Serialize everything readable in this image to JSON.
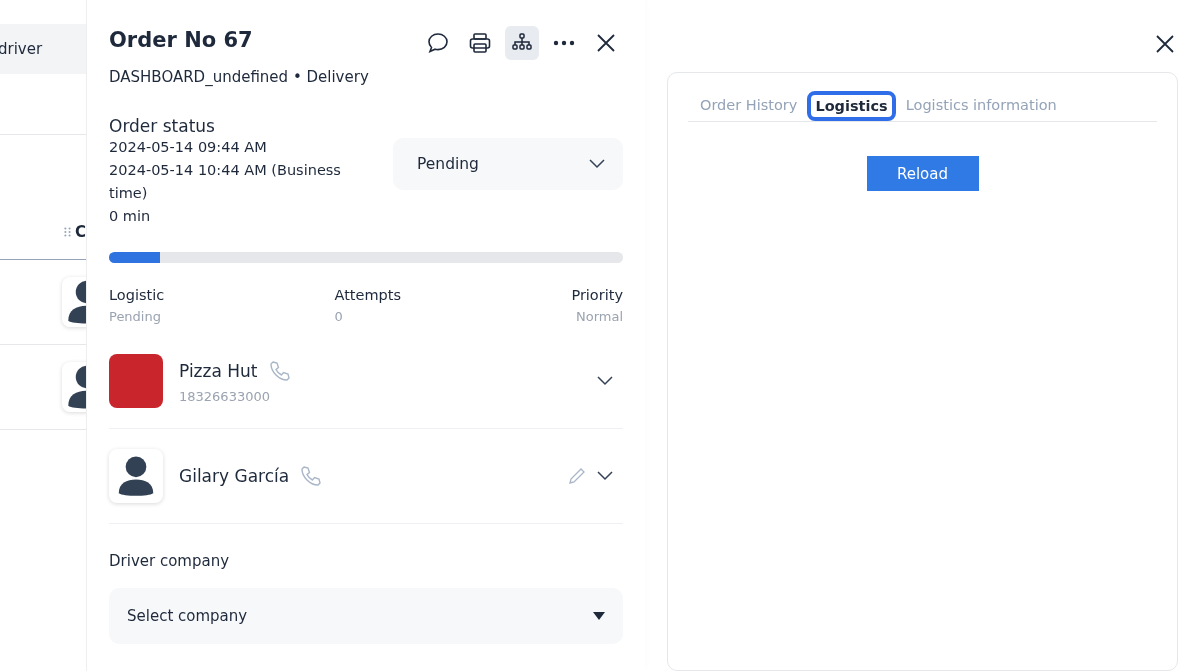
{
  "background": {
    "header_text": "driver",
    "column_header": "C",
    "rows": [
      {
        "avatar": true
      },
      {
        "avatar": true
      }
    ]
  },
  "order": {
    "title": "Order No 67",
    "subtitle": "DASHBOARD_undefined • Delivery",
    "toolbar": [
      {
        "kind": "chat",
        "selected": false
      },
      {
        "kind": "print",
        "selected": false
      },
      {
        "kind": "tree",
        "selected": true
      },
      {
        "kind": "more",
        "selected": false
      },
      {
        "kind": "close",
        "selected": false
      }
    ],
    "status_label": "Order status",
    "times": [
      "2024-05-14 09:44 AM",
      "2024-05-14 10:44 AM (Business time)",
      "0 min"
    ],
    "status_select": {
      "value": "Pending"
    },
    "progress": {
      "level": 0.1
    },
    "stats": [
      {
        "label": "Logistic",
        "value": "Pending"
      },
      {
        "label": "Attempts",
        "value": "0"
      },
      {
        "label": "Priority",
        "value": "Normal"
      }
    ],
    "contacts": [
      {
        "kind": "store",
        "name": "Pizza Hut",
        "phone": "18326633000",
        "editable": false
      },
      {
        "kind": "driver",
        "name": "Gilary García",
        "editable": true
      }
    ],
    "driver_company": {
      "label": "Driver company",
      "value": "Select company"
    }
  },
  "details": {
    "tabs": [
      {
        "label": "Order History",
        "selected": false
      },
      {
        "label": "Logistics",
        "selected": true
      },
      {
        "label": "Logistics information",
        "selected": false
      }
    ],
    "button": "Reload"
  }
}
